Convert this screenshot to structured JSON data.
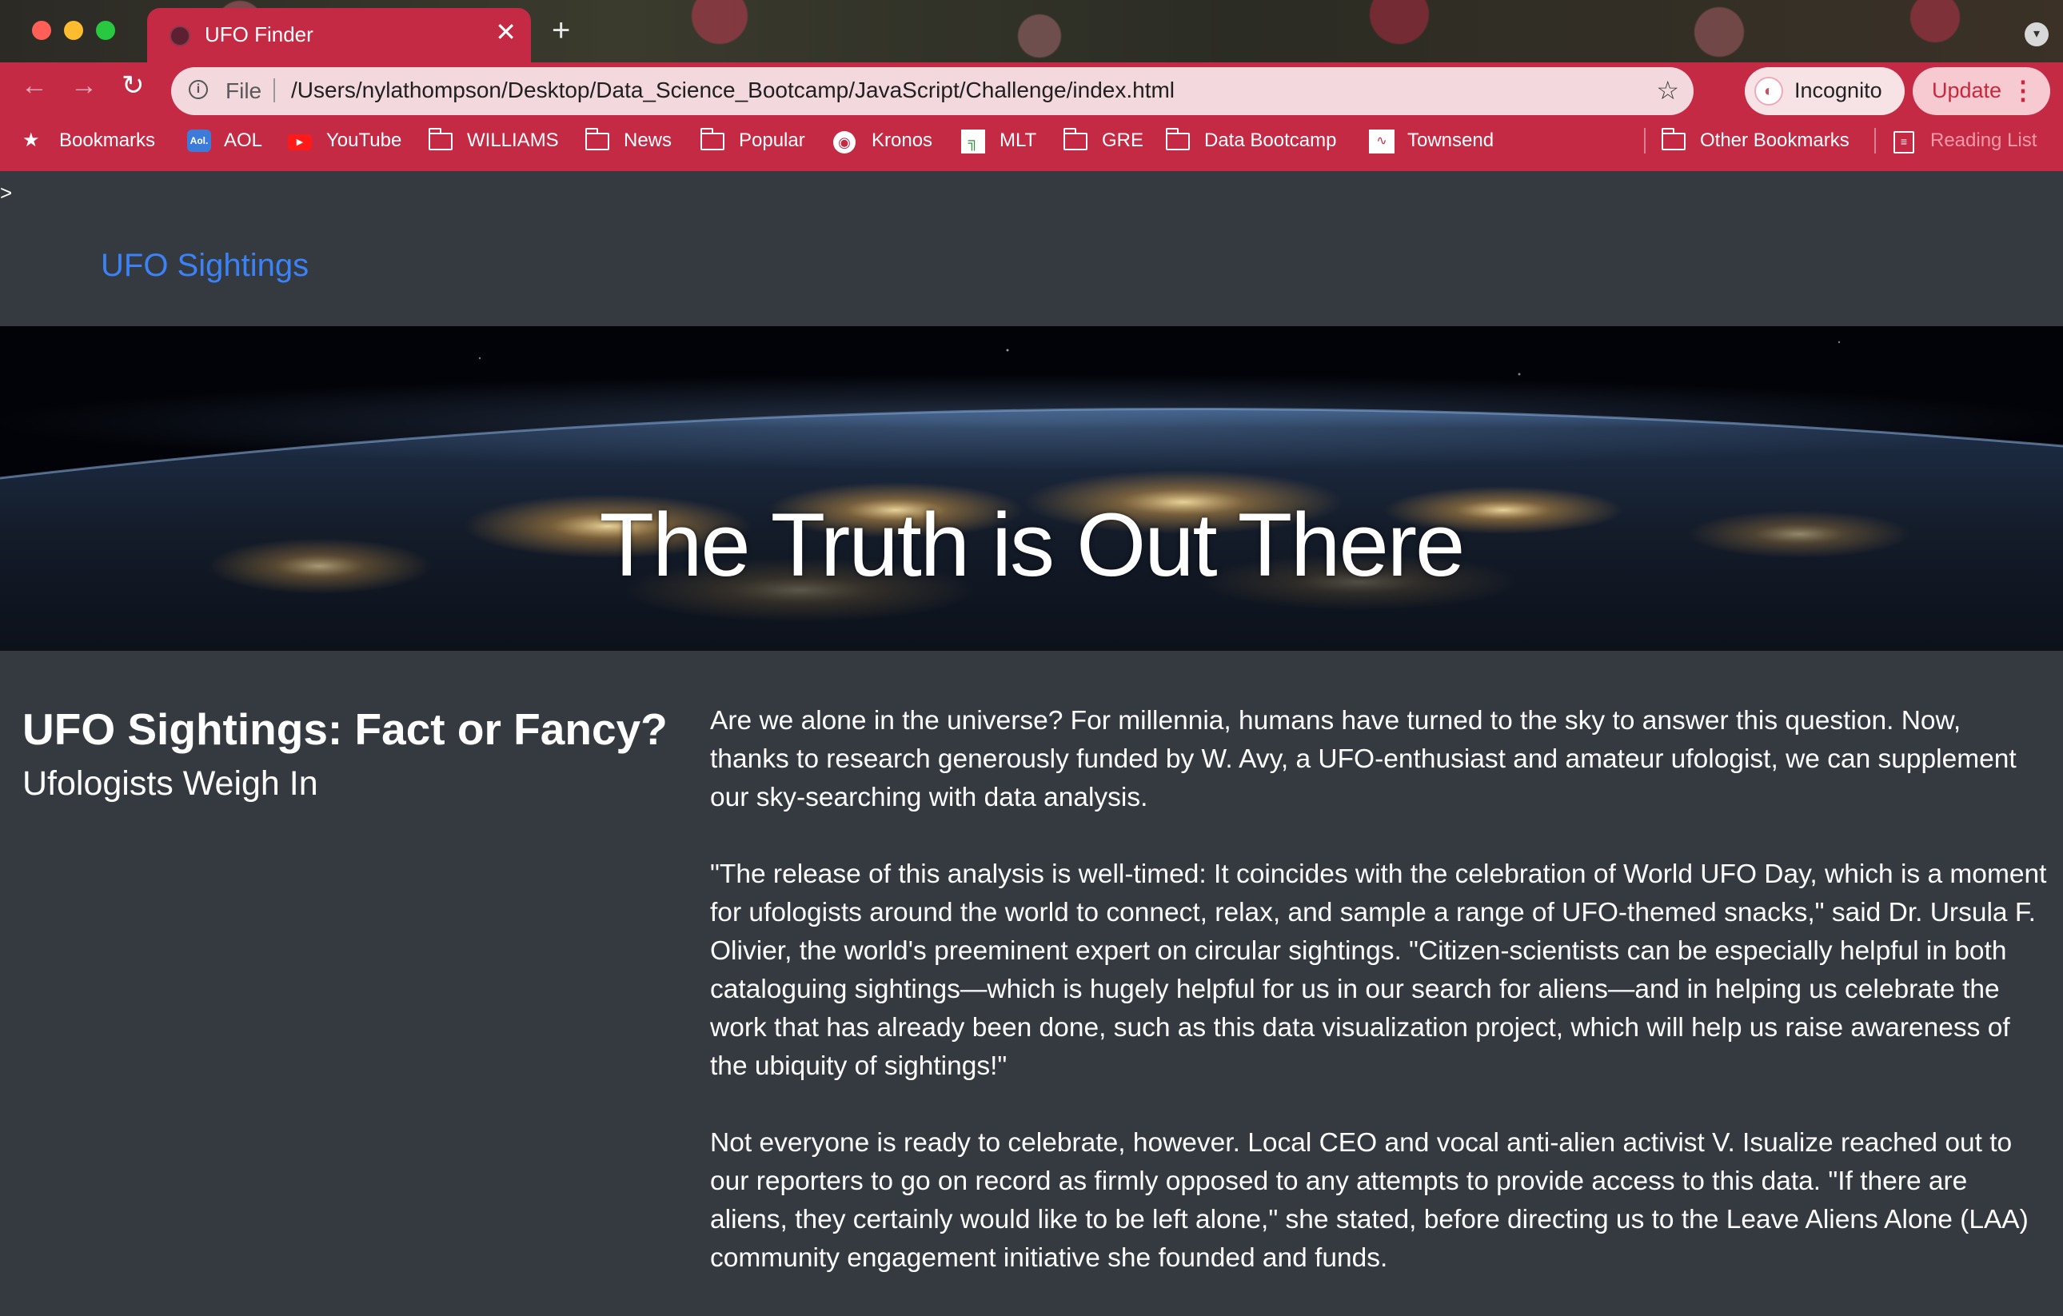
{
  "browser": {
    "tab_title": "UFO Finder",
    "tab_close": "✕",
    "new_tab": "+",
    "nav": {
      "back": "←",
      "forward": "→",
      "reload": "↻"
    },
    "address": {
      "scheme_label": "File",
      "url": "/Users/nylathompson/Desktop/Data_Science_Bootcamp/JavaScript/Challenge/index.html"
    },
    "profile_label": "Incognito",
    "update_label": "Update",
    "menu_glyph": "⋮",
    "star_glyph": "☆",
    "bookmarks": [
      {
        "label": "Bookmarks",
        "icon": "star-icon"
      },
      {
        "label": "AOL",
        "icon": "aol-icon"
      },
      {
        "label": "YouTube",
        "icon": "youtube-icon"
      },
      {
        "label": "WILLIAMS",
        "icon": "folder-icon"
      },
      {
        "label": "News",
        "icon": "folder-icon"
      },
      {
        "label": "Popular",
        "icon": "folder-icon"
      },
      {
        "label": "Kronos",
        "icon": "globe-icon"
      },
      {
        "label": "MLT",
        "icon": "mlt-icon"
      },
      {
        "label": "GRE",
        "icon": "folder-icon"
      },
      {
        "label": "Data Bootcamp",
        "icon": "folder-icon"
      },
      {
        "label": "Townsend",
        "icon": "townsend-icon"
      }
    ],
    "other_bookmarks": "Other Bookmarks",
    "reading_list": "Reading List"
  },
  "page": {
    "stray_char": ">",
    "brand": "UFO Sightings",
    "hero_title": "The Truth is Out There",
    "heading": "UFO Sightings: Fact or Fancy?",
    "subheading": "Ufologists Weigh In",
    "paragraphs": [
      "Are we alone in the universe? For millennia, humans have turned to the sky to answer this question. Now, thanks to research generously funded by W. Avy, a UFO-enthusiast and amateur ufologist, we can supplement our sky-searching with data analysis.",
      "\"The release of this analysis is well-timed: It coincides with the celebration of World UFO Day, which is a moment for ufologists around the world to connect, relax, and sample a range of UFO-themed snacks,\" said Dr. Ursula F. Olivier, the world's preeminent expert on circular sightings. \"Citizen-scientists can be especially helpful in both cataloguing sightings—which is hugely helpful for us in our search for aliens—and in helping us celebrate the work that has already been done, such as this data visualization project, which will help us raise awareness of the ubiquity of sightings!\"",
      "Not everyone is ready to celebrate, however. Local CEO and vocal anti-alien activist V. Isualize reached out to our reporters to go on record as firmly opposed to any attempts to provide access to this data. \"If there are aliens, they certainly would like to be left alone,\" she stated, before directing us to the Leave Aliens Alone (LAA) community engagement initiative she founded and funds."
    ]
  },
  "colors": {
    "chrome_accent": "#c52a45",
    "page_background": "#343a40",
    "brand_link": "#3b82f6"
  }
}
